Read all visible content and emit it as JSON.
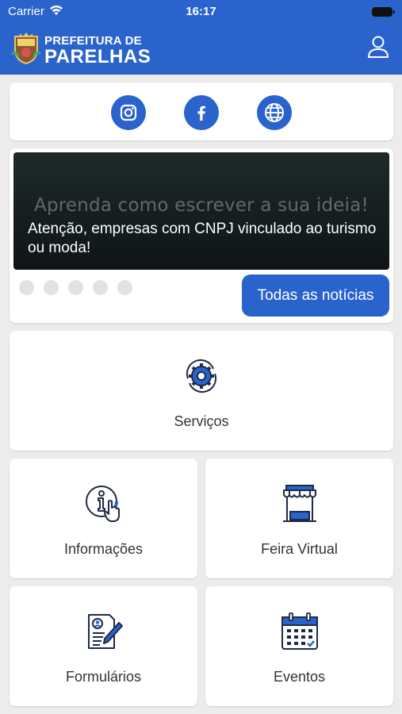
{
  "status_bar": {
    "carrier": "Carrier",
    "time": "16:17"
  },
  "header": {
    "logo_line1": "PREFEITURA DE",
    "logo_line2": "PARELHAS"
  },
  "social": {
    "icons": [
      "instagram-icon",
      "facebook-icon",
      "globe-icon"
    ]
  },
  "news": {
    "banner_background_text": "Aprenda como escrever a sua ideia!",
    "caption": "Atenção, empresas com CNPJ vinculado ao turismo ou moda!",
    "dot_count": 5,
    "all_news_label": "Todas as notícias"
  },
  "menu": {
    "services": "Serviços",
    "info": "Informações",
    "feira": "Feira Virtual",
    "forms": "Formulários",
    "events": "Eventos"
  },
  "colors": {
    "brand_blue": "#2a63cc",
    "icon_navy": "#1f2a44",
    "background": "#ececec"
  }
}
